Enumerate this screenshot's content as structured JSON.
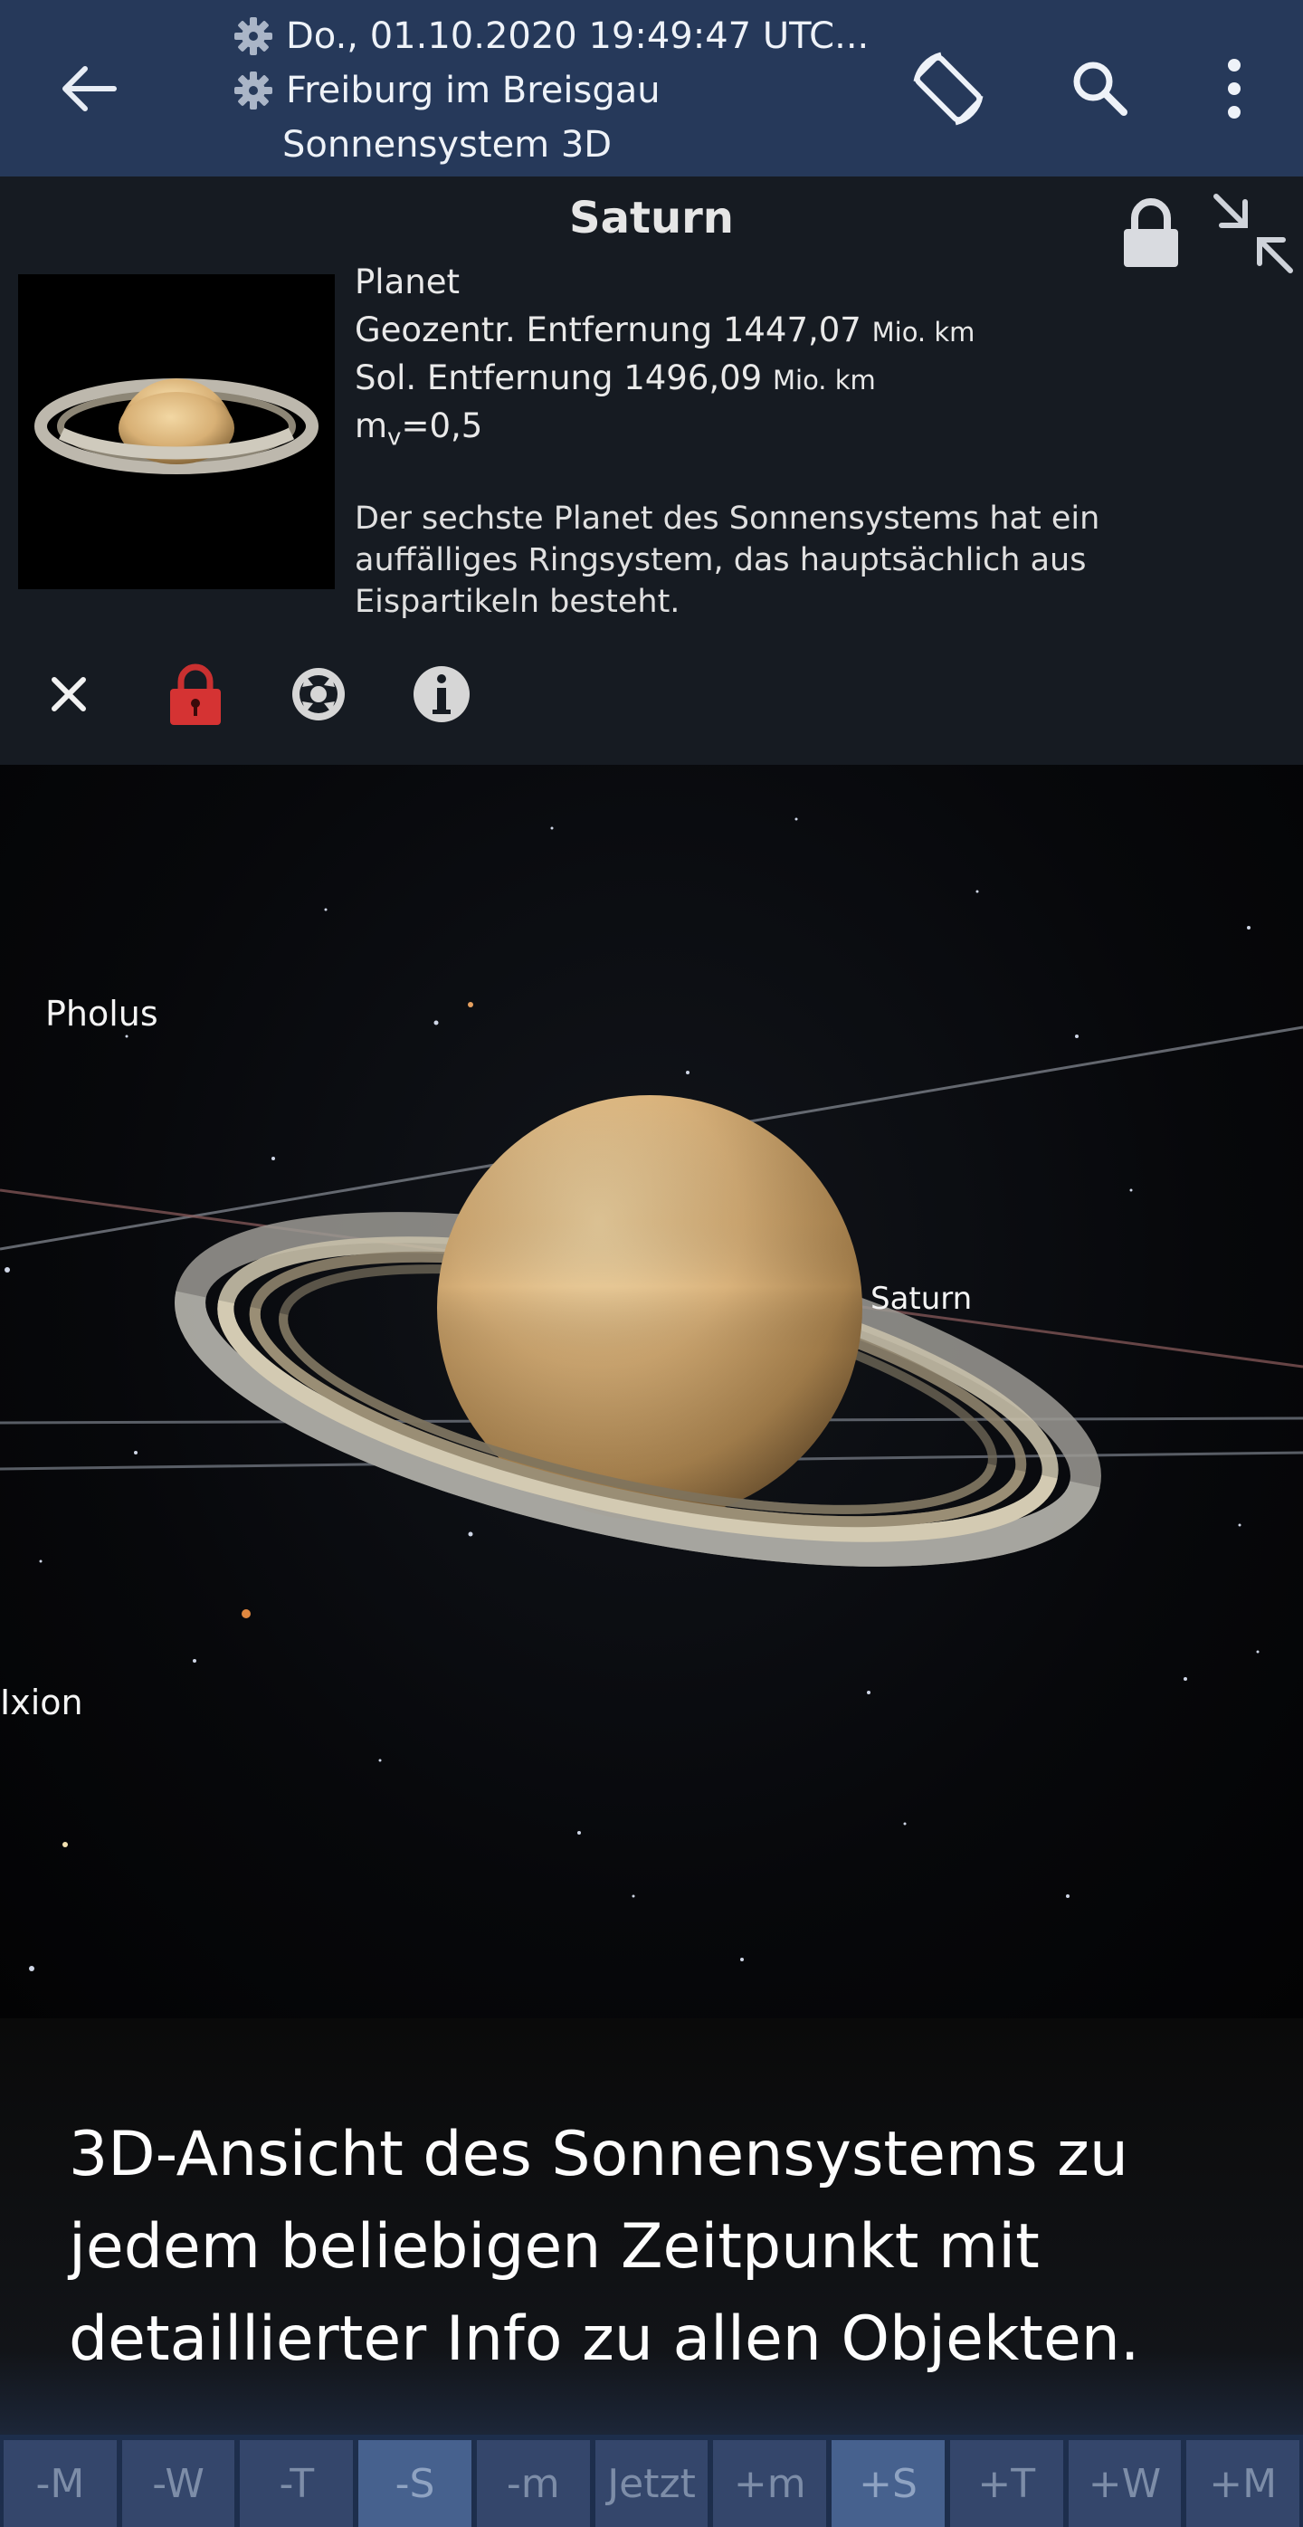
{
  "appbar": {
    "datetime": "Do., 01.10.2020 19:49:47 UTC...",
    "location": "Freiburg im Breisgau",
    "view_name": "Sonnensystem 3D",
    "icons": [
      "arrow-back-icon",
      "gear-icon",
      "screen-rotation-icon",
      "search-icon",
      "more-vert-icon"
    ]
  },
  "object": {
    "name": "Saturn",
    "type": "Planet",
    "geo_distance_label": "Geozentr. Entfernung 1447,07",
    "geo_distance_unit": "Mio. km",
    "sol_distance_label": "Sol. Entfernung 1496,09",
    "sol_distance_unit": "Mio. km",
    "magnitude_prefix": "m",
    "magnitude_sub": "v",
    "magnitude_value": "=0,5",
    "description": "Der sechste Planet des Sonnensystems hat ein auffälliges Ringsystem, das hauptsächlich aus Eispartikeln besteht.",
    "tools": [
      "close-icon",
      "lock-red-icon",
      "center-target-icon",
      "info-icon"
    ]
  },
  "view3d": {
    "labels": {
      "pholus": "Pholus",
      "saturn": "Saturn",
      "ixion": "Ixion"
    }
  },
  "caption": {
    "text": "3D-Ansicht des Sonnensystems zu jedem beliebigen Zeitpunkt mit detaillierter Info zu allen Objekten."
  },
  "timebar": {
    "buttons": [
      "-M",
      "-W",
      "-T",
      "-S",
      "-m",
      "Jetzt",
      "+m",
      "+S",
      "+T",
      "+W",
      "+M"
    ],
    "active": [
      "-S",
      "+S"
    ]
  },
  "colors": {
    "appbar_bg": "#26395a",
    "panel_bg": "#161b22",
    "timebar_bg": "#1d2e4c",
    "timebar_button": "#34466b",
    "timebar_button_active": "#46618e"
  }
}
